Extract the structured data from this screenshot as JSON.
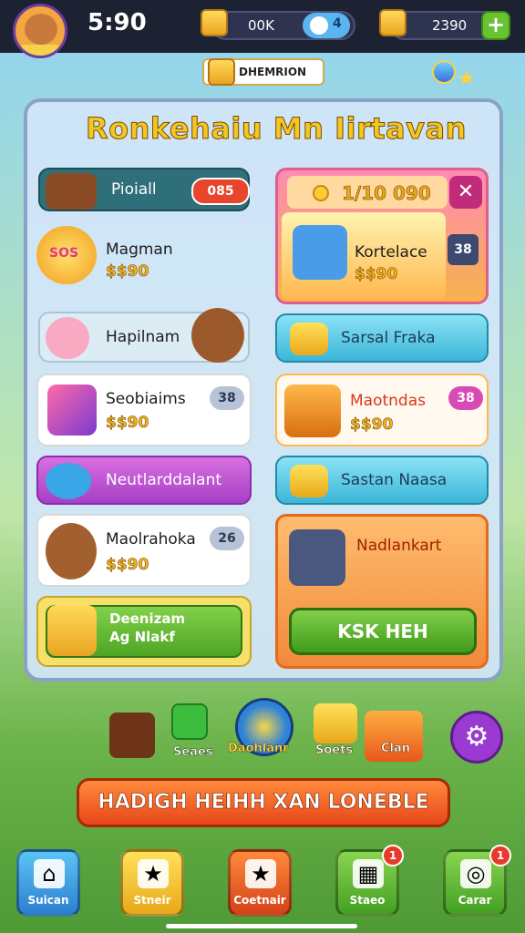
{
  "status": {
    "clock": "5:90"
  },
  "resources": {
    "gold_value": "00K",
    "gem_value": "4",
    "coins_value": "2390"
  },
  "banner": {
    "label": "DHEMRION"
  },
  "panel": {
    "title": "Ronkehaiu Mn Iirtavan",
    "left": [
      {
        "name": "Pioiall",
        "badge": "085"
      },
      {
        "name": "Magman",
        "price": "$$90",
        "icon_text": "SOS"
      },
      {
        "name": "Hapilnam"
      },
      {
        "name": "Seobiaims",
        "price": "$$90",
        "badge": "38"
      },
      {
        "name": "Neutlarddalant"
      },
      {
        "name": "Maolrahoka",
        "price": "$$90",
        "badge": "26"
      },
      {
        "line1": "Deenizam",
        "line2": "Ag Nlakf"
      }
    ],
    "right": [
      {
        "header_value": "1/10 090",
        "name": "Kortelace",
        "price": "$$90",
        "side_badge": "38"
      },
      {
        "name": "Sarsal Fraka"
      },
      {
        "name": "Maotndas",
        "price": "$$90",
        "badge": "38"
      },
      {
        "name": "Sastan Naasa"
      },
      {
        "name": "Nadlankart",
        "button": "KSK HEH"
      }
    ]
  },
  "rewards": {
    "r2_label": "Seaes",
    "r3_label": "Daohlanr",
    "r4_label": "Soets",
    "r5_label": "Clan"
  },
  "cta": "HADIGH HEIHH XAN LONEBLE",
  "nav": [
    {
      "label": "Suican",
      "icon": "home-icon"
    },
    {
      "label": "Stneir",
      "icon": "star-icon"
    },
    {
      "label": "Coetnair",
      "icon": "star-icon"
    },
    {
      "label": "Staeo",
      "icon": "shop-icon",
      "notification": "1"
    },
    {
      "label": "Carar",
      "icon": "compass-icon",
      "notification": "1"
    }
  ],
  "colors": {
    "accent_gold": "#f2c623",
    "accent_green": "#4ea523",
    "accent_orange": "#e8461a"
  }
}
